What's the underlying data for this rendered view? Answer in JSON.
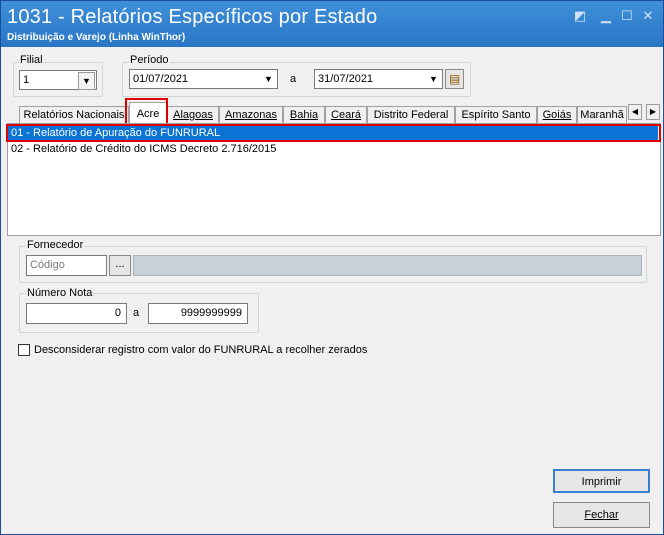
{
  "window": {
    "title": "1031 - Relatórios Específicos por Estado",
    "subtitle": "Distribuição e Varejo (Linha WinThor)"
  },
  "filial": {
    "label": "Filial",
    "value": "1"
  },
  "periodo": {
    "label": "Período",
    "start": "01/07/2021",
    "separator": "a",
    "end": "31/07/2021"
  },
  "tabs": [
    {
      "label": "Relatórios Nacionais"
    },
    {
      "label": "Acre"
    },
    {
      "label": "Alagoas"
    },
    {
      "label": "Amazonas"
    },
    {
      "label": "Bahia"
    },
    {
      "label": "Ceará"
    },
    {
      "label": "Distrito Federal"
    },
    {
      "label": "Espírito Santo"
    },
    {
      "label": "Goiás"
    },
    {
      "label": "Maranhã"
    }
  ],
  "reports": [
    {
      "label": "01 - Relatório de Apuração do FUNRURAL"
    },
    {
      "label": "02 - Relatório de Crédito do ICMS Decreto 2.716/2015"
    }
  ],
  "fornecedor": {
    "label": "Fornecedor",
    "placeholder": "Código",
    "browse": "...",
    "name": ""
  },
  "numero_nota": {
    "label": "Número Nota",
    "from": "0",
    "separator": "a",
    "to": "9999999999"
  },
  "checkbox": {
    "label": "Desconsiderar registro com valor do FUNRURAL a recolher zerados",
    "checked": false
  },
  "buttons": {
    "print": "Imprimir",
    "close": "Fechar"
  }
}
